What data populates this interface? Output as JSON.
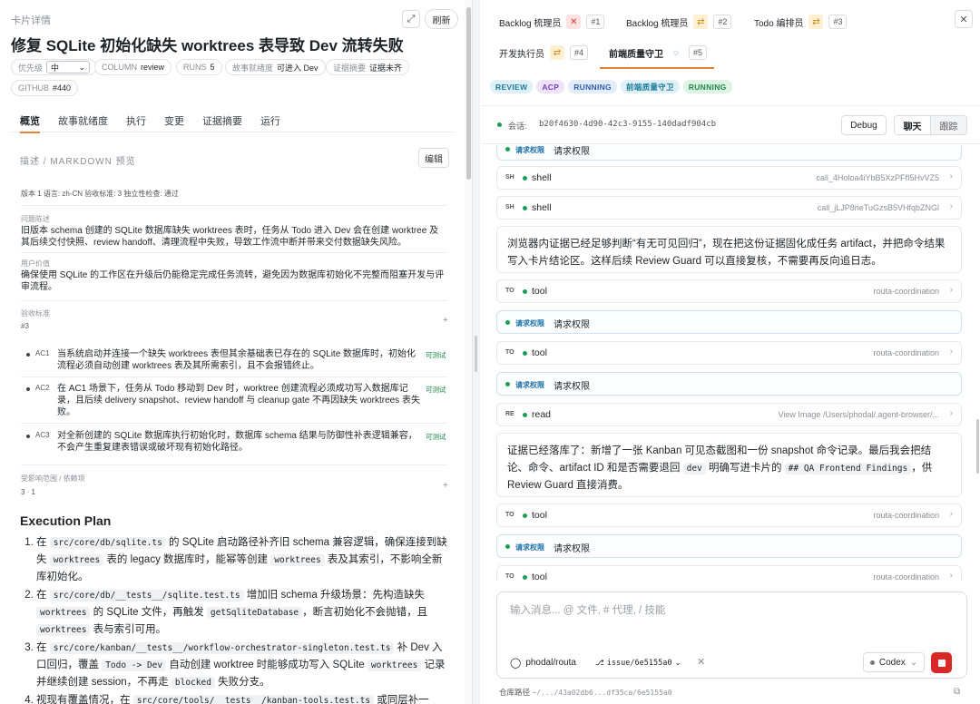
{
  "card": {
    "label": "卡片详情",
    "title": "修复 SQLite 初始化缺失 worktrees 表导致 Dev 流转失败",
    "refresh_label": "刷新",
    "priority_label": "优先级",
    "priority_value": "中",
    "column_label": "COLUMN",
    "column_value": "review",
    "runs_label": "RUNS",
    "runs_value": "5",
    "story_label": "故事就绪度",
    "story_value": "可进入 Dev",
    "evidence_label": "证据摘要",
    "evidence_value": "证据未齐",
    "github_label": "GITHUB",
    "github_value": "#440"
  },
  "tabs": [
    "概览",
    "故事就绪度",
    "执行",
    "变更",
    "证据摘要",
    "运行"
  ],
  "description": {
    "title": "描述 / MARKDOWN 预览",
    "edit_label": "编辑",
    "meta": "版本 1  语言: zh-CN  验收标准: 3  独立性检查: 通过",
    "problem_label": "问题陈述",
    "problem_text": "旧版本 schema 创建的 SQLite 数据库缺失 worktrees 表时，任务从 Todo 进入 Dev 会在创建 worktree 及其后续交付快照、review handoff、清理流程中失败，导致工作流中断并带来交付数据缺失风险。",
    "value_label": "用户价值",
    "value_text": "确保使用 SQLite 的工作区在升级后仍能稳定完成任务流转，避免因为数据库初始化不完整而阻塞开发与评审流程。",
    "criteria_label": "验收标准",
    "criteria_count": "#3",
    "criteria": [
      {
        "code": "AC1",
        "text": "当系统启动并连接一个缺失 worktrees 表但其余基础表已存在的 SQLite 数据库时，初始化流程必须自动创建 worktrees 表及其所需索引，且不会报错终止。",
        "badge": "可测试"
      },
      {
        "code": "AC2",
        "text": "在 AC1 场景下，任务从 Todo 移动到 Dev 时，worktree 创建流程必须成功写入数据库记录，且后续 delivery snapshot、review handoff 与 cleanup gate 不再因缺失 worktrees 表失败。",
        "badge": "可测试"
      },
      {
        "code": "AC3",
        "text": "对全新创建的 SQLite 数据库执行初始化时，数据库 schema 结果与防御性补表逻辑兼容，不会产生重复建表错误或破坏现有初始化路径。",
        "badge": "可测试"
      }
    ],
    "deps_label": "受影响范围 / 依赖项",
    "deps_value": "3 · 1"
  },
  "plan": {
    "title": "Execution Plan",
    "items": [
      {
        "a": "在 ",
        "c1": "src/core/db/sqlite.ts",
        "b": " 的 SQLite 启动路径补齐旧 schema 兼容逻辑，确保连接到缺失 ",
        "c2": "worktrees",
        "c": " 表的 legacy 数据库时，能幂等创建 ",
        "c3": "worktrees",
        "d": " 表及其索引，不影响全新库初始化。"
      },
      {
        "a": "在 ",
        "c1": "src/core/db/__tests__/sqlite.test.ts",
        "b": " 增加旧 schema 升级场景：先构造缺失 ",
        "c2": "worktrees",
        "c": " 的 SQLite 文件，再触发 ",
        "c3": "getSqliteDatabase",
        "d": "，断言初始化不会抛错，且 ",
        "c4": "worktrees",
        "e": " 表与索引可用。"
      },
      {
        "a": "在 ",
        "c1": "src/core/kanban/__tests__/workflow-orchestrator-singleton.test.ts",
        "b": " 补 Dev 入口回归，覆盖 ",
        "c2": "Todo -> Dev",
        "c": " 自动创建 worktree 时能够成功写入 SQLite ",
        "c3": "worktrees",
        "d": " 记录并继续创建 session，不再走 ",
        "c4": "blocked",
        "e": " 失败分支。"
      },
      {
        "a": "视现有覆盖情况，在 ",
        "c1": "src/core/tools/__tests__/kanban-tools.test.ts",
        "b": " 或同层补一",
        "c2": "",
        "c": "",
        "c3": "",
        "d": ""
      }
    ]
  },
  "right": {
    "tabs": [
      {
        "label": "Backlog 梳理员",
        "icon": "x-icon",
        "num": "#1"
      },
      {
        "label": "Backlog 梳理员",
        "icon": "swap-icon",
        "num": "#2"
      },
      {
        "label": "Todo 编排员",
        "icon": "swap-icon",
        "num": "#3"
      },
      {
        "label": "开发执行员",
        "icon": "swap-icon",
        "num": "#4"
      },
      {
        "label": "前端质量守卫",
        "icon": "spinner-icon",
        "num": "#5"
      }
    ],
    "status_tags": [
      "REVIEW",
      "ACP",
      "RUNNING",
      "前端质量守卫",
      "RUNNING"
    ],
    "session_label": "会话:",
    "session_id": "b20f4630-4d90-42c3-9155-140dadf904cb",
    "debug_label": "Debug",
    "chat_label": "聊天",
    "trace_label": "跟踪",
    "feed": {
      "perm0_label": "请求权限",
      "perm0_text": "请求权限",
      "sh1_kind": "SH",
      "sh1_name": "shell",
      "sh1_ref": "call_4Holoa4iYbB5XzPFfI5HvVZ5",
      "sh2_kind": "SH",
      "sh2_name": "shell",
      "sh2_ref": "call_jLJP8rieTuGzsB5VHfqbZNGl",
      "msg1": "浏览器内证据已经足够判断“有无可见回归”，现在把这份证据固化成任务 artifact，并把命令结果写入卡片结论区。这样后续 Review Guard 可以直接复核，不需要再反向追日志。",
      "to1_kind": "TO",
      "to1_name": "tool",
      "to1_ref": "routa-coordination",
      "perm1_label": "请求权限",
      "perm1_text": "请求权限",
      "to2_kind": "TO",
      "to2_name": "tool",
      "to2_ref": "routa-coordination",
      "perm2_label": "请求权限",
      "perm2_text": "请求权限",
      "re_kind": "RE",
      "re_name": "read",
      "re_ref": "View Image /Users/phodal/.agent-browser/...",
      "msg2_a": "证据已经落库了：新增了一张 Kanban 可见态截图和一份 snapshot 命令记录。最后我会把结论、命令、artifact ID 和是否需要退回 ",
      "msg2_code1": "dev",
      "msg2_b": " 明确写进卡片的 ",
      "msg2_code2": "## QA Frontend Findings",
      "msg2_c": "，供 Review Guard 直接消费。",
      "to3_kind": "TO",
      "to3_name": "tool",
      "to3_ref": "routa-coordination",
      "perm3_label": "请求权限",
      "perm3_text": "请求权限",
      "to4_kind": "TO",
      "to4_name": "tool",
      "to4_ref": "routa-coordination"
    },
    "composer": {
      "placeholder": "输入消息... @ 文件, # 代理, / 技能",
      "repo": "phodal/routa",
      "branch": "issue/6e5155a0",
      "model": "Codex"
    },
    "workspace_label": "仓库路径",
    "workspace_path": "~/.../43a02db6...df35ca/6e5155a0"
  },
  "colors": {
    "accent": "#e0823a",
    "running_green": "#1f9d55",
    "stop_red": "#d92828"
  }
}
